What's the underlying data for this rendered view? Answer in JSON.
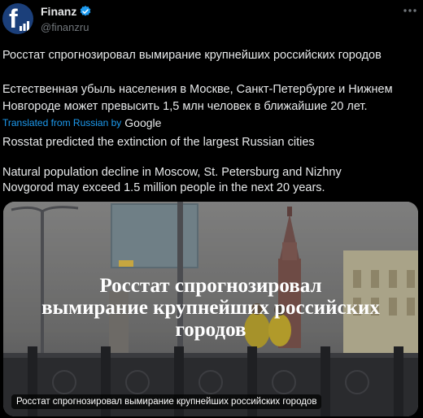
{
  "author": {
    "display_name": "Finanz",
    "handle": "@finanzru",
    "avatar_letter": "f",
    "verified_color": "#1d9bf0"
  },
  "post": {
    "original": {
      "title": "Росстат спрогнозировал вымирание крупнейших российских городов",
      "body_line1": "Естественная убыль населения в Москве, Санкт-Петербурге и Нижнем",
      "body_line2": "Новгороде может превысить 1,5  млн человек в ближайшие 20 лет."
    },
    "translation_note": "Translated from Russian by",
    "translation_provider": "Google",
    "translated": {
      "title": "Rosstat predicted the extinction of the largest Russian cities",
      "body_line1": "Natural population decline in Moscow, St. Petersburg and Nizhny",
      "body_line2": "Novgorod may exceed 1.5 million people in the next 20 years."
    }
  },
  "media": {
    "overlay_line1": "Росстат спрогнозировал",
    "overlay_line2": "вымирание крупнейших российских",
    "overlay_line3": "городов",
    "caption": "Росстат спрогнозировал вымирание крупнейших российских городов"
  },
  "colors": {
    "background": "#000000",
    "text": "#e7e9ea",
    "muted": "#71767b",
    "link": "#1d9bf0"
  }
}
